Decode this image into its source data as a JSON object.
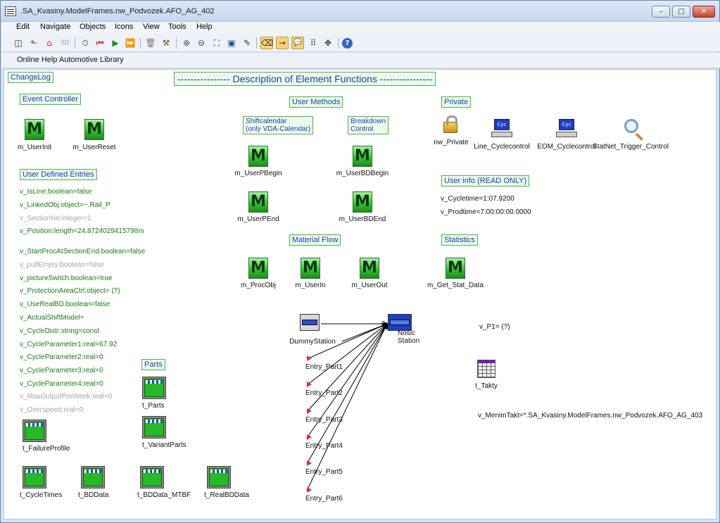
{
  "window": {
    "title": ".SA_Kvasiny.ModelFrames.nw_Podvozek.AFO_AG_402",
    "controls": {
      "minimize": "–",
      "maximize": "□",
      "close": "✕"
    }
  },
  "menu": [
    "Edit",
    "Navigate",
    "Objects",
    "Icons",
    "View",
    "Tools",
    "Help"
  ],
  "toolbar": {
    "buttons": [
      {
        "icon": "binoculars-icon",
        "glyph": "◫"
      },
      {
        "icon": "open-parent-icon",
        "glyph": "⬑"
      },
      {
        "icon": "home-icon",
        "glyph": "⌂"
      },
      {
        "icon": "3d-icon",
        "glyph": "3D"
      },
      {
        "icon": "event-controller-icon",
        "glyph": "⏱"
      },
      {
        "icon": "reset-icon",
        "glyph": "⏮"
      },
      {
        "icon": "start-icon",
        "glyph": "▶"
      },
      {
        "icon": "fast-forward-icon",
        "glyph": "⏩"
      },
      {
        "icon": "delete-icon",
        "glyph": "🗑"
      },
      {
        "icon": "sweep-icon",
        "glyph": "⚒"
      },
      {
        "icon": "zoom-in-icon",
        "glyph": "⊕"
      },
      {
        "icon": "zoom-out-icon",
        "glyph": "⊖"
      },
      {
        "icon": "zoom-fit-icon",
        "glyph": "⛶"
      },
      {
        "icon": "zoom-box-icon",
        "glyph": "▣"
      },
      {
        "icon": "pencil-icon",
        "glyph": "✎"
      },
      {
        "icon": "eraser-icon",
        "glyph": "⌫"
      },
      {
        "icon": "connector-icon",
        "glyph": "→"
      },
      {
        "icon": "tooltip-icon",
        "glyph": "💬"
      },
      {
        "icon": "grid-icon",
        "glyph": "⠿"
      },
      {
        "icon": "network-icon",
        "glyph": "✥"
      },
      {
        "icon": "help-icon",
        "glyph": "?"
      }
    ]
  },
  "help_bar": {
    "label": "Online Help Automotive Library"
  },
  "comments": {
    "changelog": "ChangeLog",
    "description": "---------------- Description of Element Functions ----------------",
    "event_controller": "Event Controller",
    "user_methods": "User Methods",
    "private": "Private",
    "user_defined": "User Defined Entries",
    "shiftcalendar": "Shiftcalendar\n(only VDA-Calendar)",
    "breakdown": "Breakdown\nControl",
    "user_info": "User info (READ ONLY)",
    "material_flow": "Material Flow",
    "statistics": "Statistics",
    "parts": "Parts"
  },
  "attributes": [
    {
      "text": "v_IsLine:boolean=false",
      "style": "green"
    },
    {
      "text": "v_LinkedObj:object=~.Rail_P",
      "style": "green"
    },
    {
      "text": "v_SectionNo:integer=1",
      "style": "grey"
    },
    {
      "text": "v_Position:length=24.8724029415798m",
      "style": "green"
    },
    {
      "text": "v_StartProcAtSectionEnd:boolean=false",
      "style": "green"
    },
    {
      "text": "v_pullEmpty:boolean=false",
      "style": "grey"
    },
    {
      "text": "v_pictureSwitch:boolean=true",
      "style": "green"
    },
    {
      "text": "v_ProtectionAreaCtrl:object= (?)",
      "style": "green"
    },
    {
      "text": "v_UseRealBD:boolean=false",
      "style": "green"
    },
    {
      "text": "v_ActualShiftModel=",
      "style": "green"
    },
    {
      "text": "v_CycleDistr:string=const",
      "style": "green"
    },
    {
      "text": "v_CycleParameter1:real=67.92",
      "style": "green"
    },
    {
      "text": "v_CycleParameter2:real=0",
      "style": "green"
    },
    {
      "text": "v_CycleParameter3:real=0",
      "style": "green"
    },
    {
      "text": "v_CycleParameter4:real=0",
      "style": "green"
    },
    {
      "text": "v_MaxOutputPerWeek:real=0",
      "style": "grey"
    },
    {
      "text": "v_Overspeed:real=0",
      "style": "grey"
    }
  ],
  "user_info": {
    "cycletime": "v_Cycletime=1:07.9200",
    "prodtime": "v_Prodtime=7:00:00:00.0000"
  },
  "misc_vars": {
    "p1": "v_P1= (?)",
    "menim_takt": "v_MenimTakt=*.SA_Kvasiny.ModelFrames.nw_Podvozek.AFO_AG_403"
  },
  "methods": {
    "user_init": "m_UserInit",
    "user_reset": "m_UserReset",
    "user_pbegin": "m_UserPBegin",
    "user_pend": "m_UserPEnd",
    "user_bdbegin": "m_UserBDBegin",
    "user_bdend": "m_UserBDEnd",
    "proc_obj": "m_ProcObj",
    "user_in": "m_UserIn",
    "user_out": "m_UserOut",
    "get_stat": "m_Get_Stat_Data",
    "glyph": "M"
  },
  "private_objects": {
    "nw_private": "nw_Private",
    "line_cycle": "Line_Cyclecontrol",
    "eom_cycle": "EOM_Cyclecontrol",
    "statnet": "StatNet_Trigger_Control",
    "pc_glyph": "Cyc"
  },
  "tables": {
    "parts": "t_Parts",
    "variant_parts": "t_VariantParts",
    "failure_profile": "t_FailureProfile",
    "cycle_times": "t_CycleTimes",
    "bd_data": "t_BDData",
    "bd_data_mtbf": "t_BDData_MTBF",
    "real_bd_data": "t_RealBDData",
    "takty": "t_Takty"
  },
  "flow": {
    "dummy_station": "DummyStation",
    "nosic_station": "Nosic\nStation",
    "sources": [
      "Entry_Part1",
      "Entry_Part2",
      "Entry_Part3",
      "Entry_Part4",
      "Entry_Part5",
      "Entry_Part6"
    ]
  }
}
